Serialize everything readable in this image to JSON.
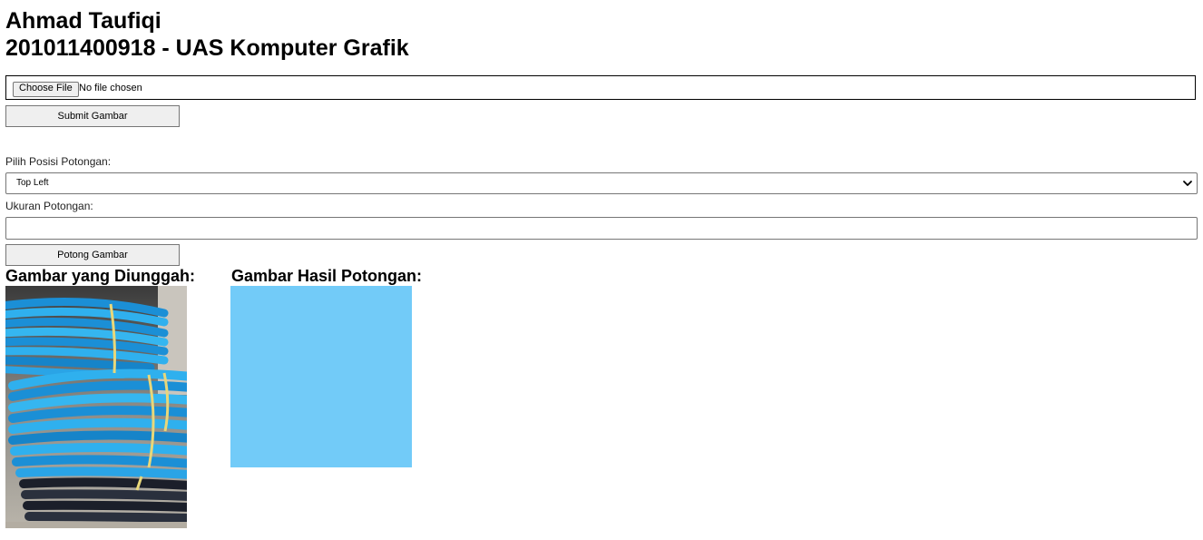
{
  "header": {
    "name": "Ahmad Taufiqi",
    "subtitle": "201011400918 - UAS Komputer Grafik"
  },
  "upload": {
    "choose_file_label": "Choose File",
    "file_status": "No file chosen",
    "submit_label": "Submit Gambar"
  },
  "crop": {
    "position_label": "Pilih Posisi Potongan:",
    "position_selected": "Top Left",
    "size_label": "Ukuran Potongan:",
    "size_value": "",
    "crop_button_label": "Potong Gambar"
  },
  "results": {
    "uploaded_heading": "Gambar yang Diunggah:",
    "cropped_heading": "Gambar Hasil Potongan:",
    "cropped_color": "#72cbf8"
  },
  "icons": {
    "select_arrow": "chevron-down-icon"
  }
}
